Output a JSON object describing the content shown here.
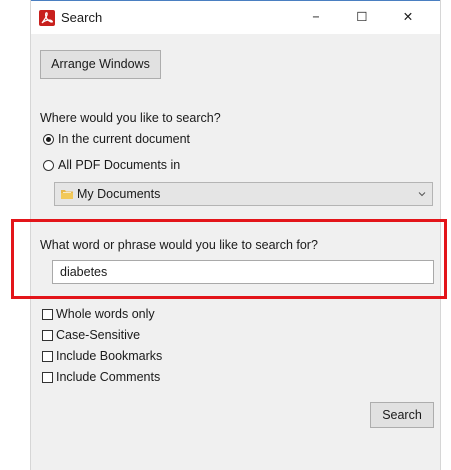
{
  "window": {
    "title": "Search",
    "controls": {
      "minimize": "−",
      "maximize": "☐",
      "close": "✕"
    }
  },
  "arrange_button": "Arrange Windows",
  "where": {
    "prompt": "Where would you like to search?",
    "options": [
      {
        "label": "In the current document",
        "checked": true
      },
      {
        "label": "All PDF Documents in",
        "checked": false
      }
    ],
    "location_select": "My Documents"
  },
  "phrase": {
    "prompt": "What word or phrase would you like to search for?",
    "value": "diabetes"
  },
  "checkboxes": [
    {
      "label": "Whole words only",
      "checked": false
    },
    {
      "label": "Case-Sensitive",
      "checked": false
    },
    {
      "label": "Include Bookmarks",
      "checked": false
    },
    {
      "label": "Include Comments",
      "checked": false
    }
  ],
  "search_button": "Search",
  "colors": {
    "highlight": "#e3151a",
    "app_icon": "#c8201d",
    "titlebar_accent": "#4a7fc1"
  }
}
